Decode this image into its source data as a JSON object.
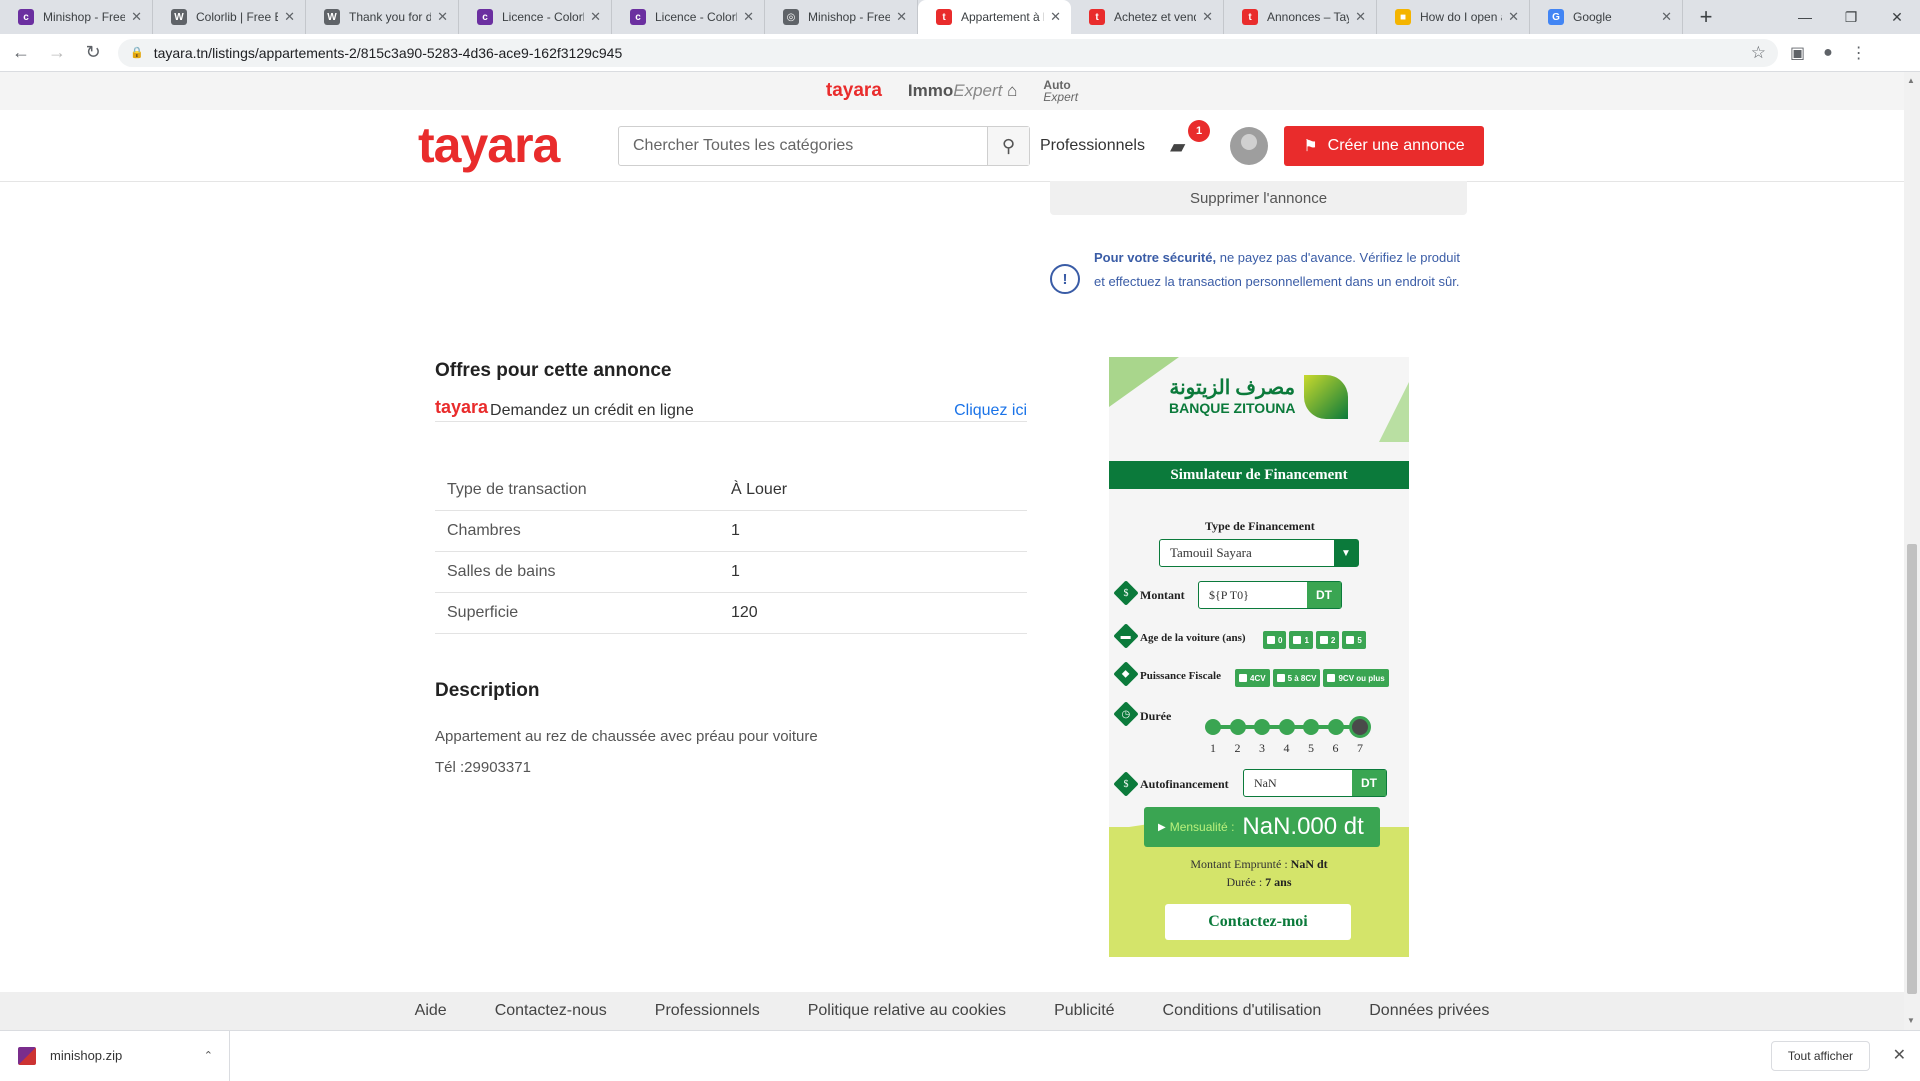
{
  "browser": {
    "tabs": [
      {
        "title": "Minishop - Free Bo",
        "fav_color": "#6b2fa0",
        "fav_text": "c"
      },
      {
        "title": "Colorlib | Free Boo",
        "fav_color": "#5f6368",
        "fav_text": "W"
      },
      {
        "title": "Thank you for dow",
        "fav_color": "#5f6368",
        "fav_text": "W"
      },
      {
        "title": "Licence - Colorlib",
        "fav_color": "#6b2fa0",
        "fav_text": "c"
      },
      {
        "title": "Licence - Colorlib",
        "fav_color": "#6b2fa0",
        "fav_text": "c"
      },
      {
        "title": "Minishop - Free Bo",
        "fav_color": "#5f6368",
        "fav_text": "◎"
      },
      {
        "title": "Appartement à lou",
        "fav_color": "#e92c2c",
        "fav_text": "t",
        "active": true
      },
      {
        "title": "Achetez et vendez",
        "fav_color": "#e92c2c",
        "fav_text": "t"
      },
      {
        "title": "Annonces – Tayara",
        "fav_color": "#e92c2c",
        "fav_text": "t"
      },
      {
        "title": "How do I open a .z",
        "fav_color": "#f4b400",
        "fav_text": "■"
      },
      {
        "title": "Google",
        "fav_color": "#4285f4",
        "fav_text": "G"
      }
    ],
    "new_tab": "+",
    "url": "tayara.tn/listings/appartements-2/815c3a90-5283-4d36-ace9-162f3129c945"
  },
  "brandstrip": {
    "tayara": "tayara",
    "immo": "Immo",
    "immo_suffix": "Expert",
    "auto": "Auto",
    "auto_suffix": "Expert"
  },
  "header": {
    "logo": "tayara",
    "search_placeholder": "Chercher Toutes les catégories",
    "professionnels": "Professionnels",
    "chat_badge": "1",
    "create_label": "Créer une annonce"
  },
  "sidebar": {
    "delete_label": "Supprimer l'annonce",
    "security_bold": "Pour votre sécurité,",
    "security_text": " ne payez pas d'avance. Vérifiez le produit et effectuez la transaction personnellement dans un endroit sûr."
  },
  "offers": {
    "title": "Offres pour cette annonce",
    "logo": "tayara",
    "text": "Demandez un crédit en ligne",
    "link": "Cliquez ici"
  },
  "attributes": [
    {
      "label": "Type de transaction",
      "value": "À Louer"
    },
    {
      "label": "Chambres",
      "value": "1"
    },
    {
      "label": "Salles de bains",
      "value": "1"
    },
    {
      "label": "Superficie",
      "value": "120"
    }
  ],
  "description": {
    "title": "Description",
    "line1": "Appartement au rez de chaussée avec préau pour voiture",
    "line2": "Tél :29903371"
  },
  "simulator": {
    "bank_ar": "مصرف الزيتونة",
    "bank_en": "BANQUE ZITOUNA",
    "title": "Simulateur de Financement",
    "type_label": "Type de Financement",
    "type_value": "Tamouil Sayara",
    "montant_label": "Montant",
    "montant_value": "${P T0}",
    "unit": "DT",
    "age_label": "Age de la voiture (ans)",
    "age_options": [
      "0",
      "1",
      "2",
      "5"
    ],
    "puissance_label": "Puissance Fiscale",
    "puissance_options": [
      "4CV",
      "5 à 8CV",
      "9CV ou plus"
    ],
    "duree_label": "Durée",
    "duree_steps": [
      "1",
      "2",
      "3",
      "4",
      "5",
      "6",
      "7"
    ],
    "duree_selected": 7,
    "auto_label": "Autofinancement",
    "auto_value": "NaN",
    "mens_label": "Mensualité :",
    "mens_value": "NaN.000 dt",
    "emprunt_label": "Montant Emprunté :",
    "emprunt_value": "NaN dt",
    "duree_res_label": "Durée :",
    "duree_res_value": "7 ans",
    "contact_label": "Contactez-moi"
  },
  "footer": [
    "Aide",
    "Contactez-nous",
    "Professionnels",
    "Politique relative au cookies",
    "Publicité",
    "Conditions d'utilisation",
    "Données privées"
  ],
  "downloads": {
    "file": "minishop.zip",
    "show_all": "Tout afficher"
  }
}
